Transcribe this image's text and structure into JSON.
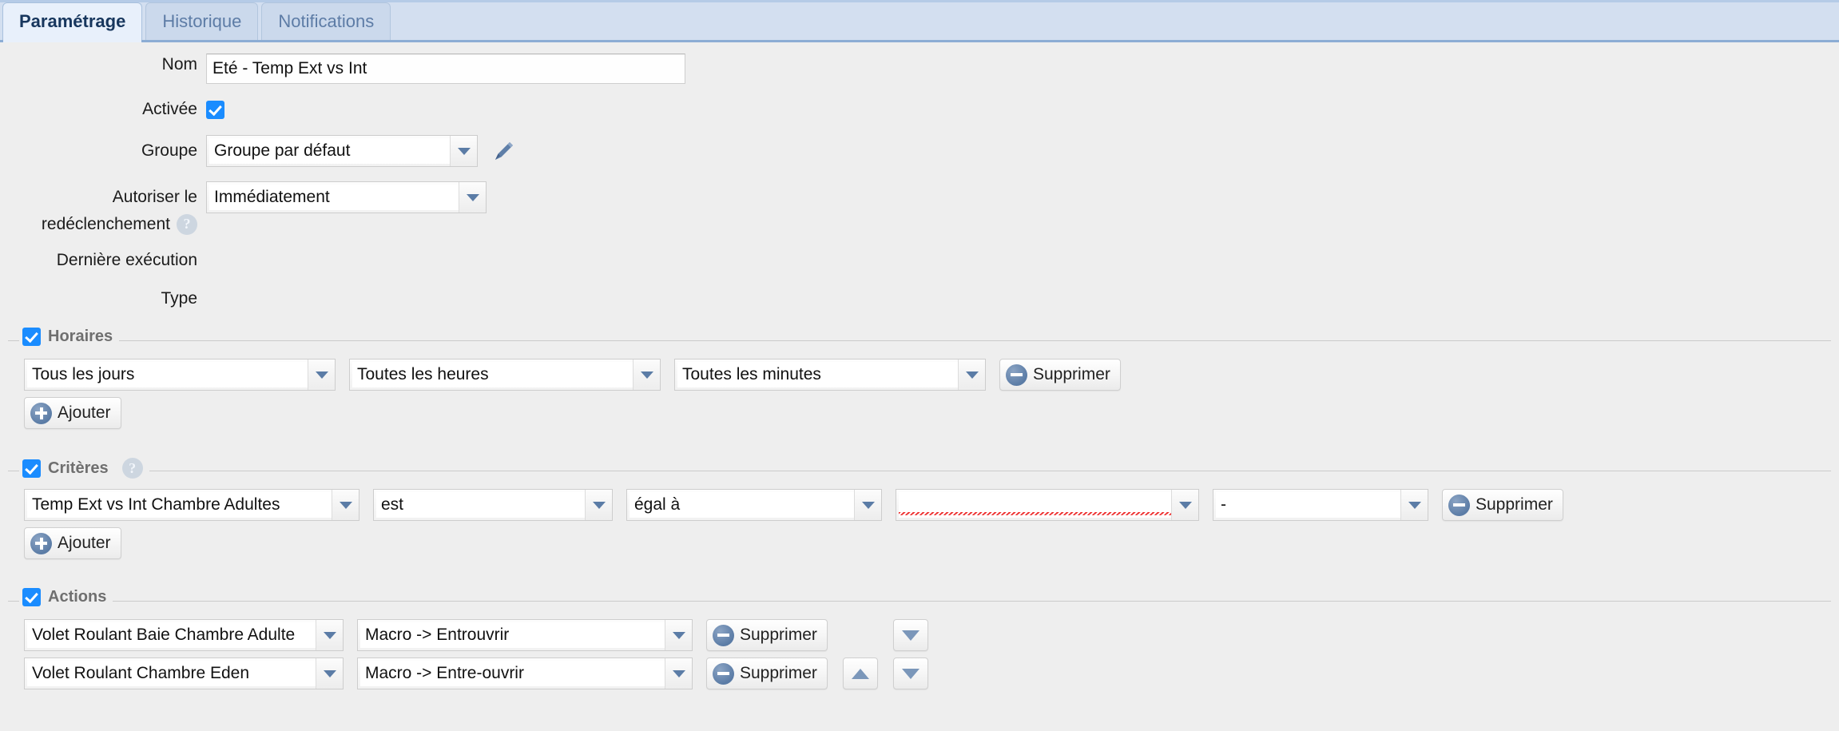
{
  "tabs": [
    {
      "label": "Paramétrage",
      "active": true
    },
    {
      "label": "Historique",
      "active": false
    },
    {
      "label": "Notifications",
      "active": false
    }
  ],
  "form": {
    "nom": {
      "label": "Nom",
      "value": "Eté - Temp Ext vs Int"
    },
    "activee": {
      "label": "Activée",
      "checked": true
    },
    "groupe": {
      "label": "Groupe",
      "value": "Groupe par défaut",
      "edit_icon": "pencil-icon"
    },
    "redeclenchement": {
      "label_line1": "Autoriser le",
      "label_line2": "redéclenchement",
      "value": "Immédiatement",
      "help_icon": "help-icon",
      "help_glyph": "?"
    },
    "derniere_execution": {
      "label": "Dernière exécution",
      "value": ""
    },
    "type": {
      "label": "Type",
      "value": ""
    }
  },
  "horaires": {
    "legend": "Horaires",
    "checked": true,
    "rows": [
      {
        "jour": "Tous les jours",
        "heure": "Toutes les heures",
        "minute": "Toutes les minutes",
        "delete_label": "Supprimer"
      }
    ],
    "add_label": "Ajouter"
  },
  "criteres": {
    "legend": "Critères",
    "checked": true,
    "help_glyph": "?",
    "rows": [
      {
        "source": "Temp Ext vs Int Chambre Adultes",
        "verb": "est",
        "operator": "égal à",
        "value": "",
        "unit": "-",
        "delete_label": "Supprimer"
      }
    ],
    "add_label": "Ajouter"
  },
  "actions": {
    "legend": "Actions",
    "checked": true,
    "rows": [
      {
        "target": "Volet Roulant Baie Chambre Adulte",
        "command": "Macro -> Entrouvrir",
        "delete_label": "Supprimer",
        "has_up": false,
        "has_down": true
      },
      {
        "target": "Volet Roulant Chambre Eden",
        "command": "Macro -> Entre-ouvrir",
        "delete_label": "Supprimer",
        "has_up": true,
        "has_down": true
      }
    ]
  },
  "colors": {
    "tabbar_bg": "#d3dff0",
    "tab_active_bg": "#e8f0fb",
    "tab_active_text": "#17365d",
    "tab_inactive_text": "#5d7ca6",
    "panel_bg": "#eeeeee",
    "checkbox_blue": "#1a8cff",
    "button_circle": "#5b7ca6",
    "spellcheck_red": "#ee3333"
  }
}
